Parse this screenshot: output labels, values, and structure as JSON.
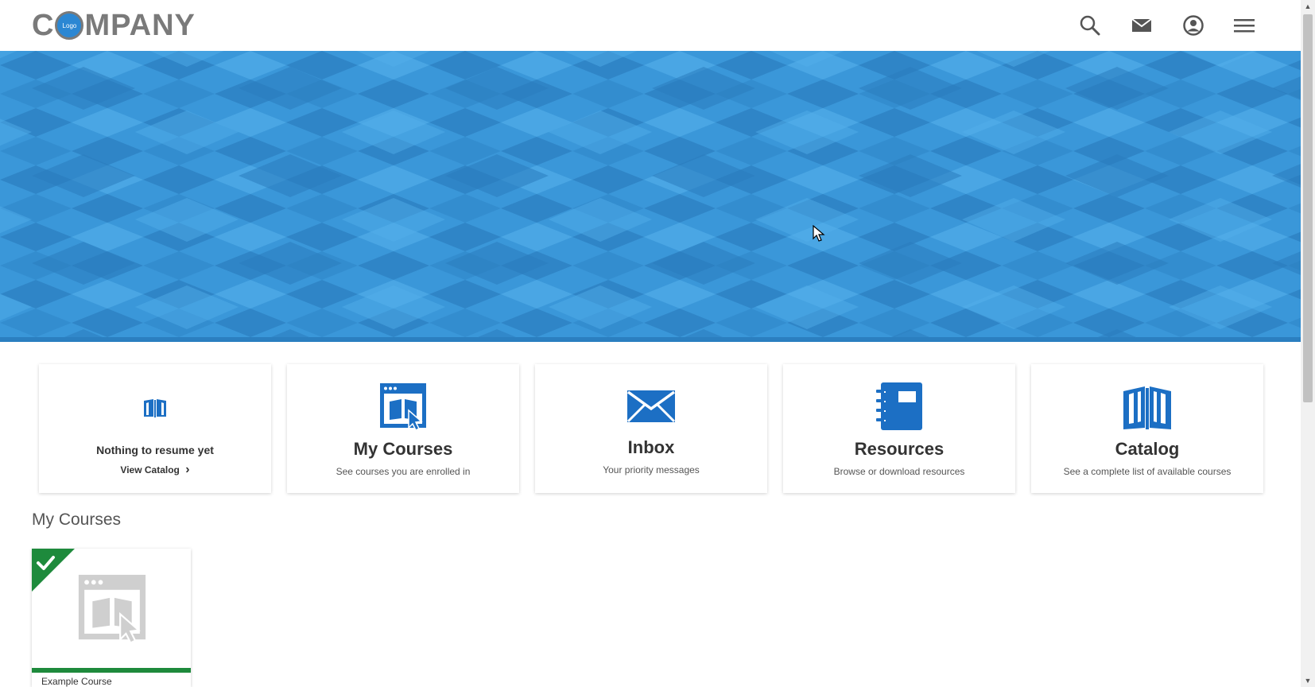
{
  "header": {
    "logo_pre": "C",
    "logo_badge": "Logo",
    "logo_post": "MPANY",
    "icons": [
      "search-icon",
      "mail-icon",
      "account-icon",
      "menu-icon"
    ]
  },
  "banner": {
    "color": "#3a97d9"
  },
  "tiles": {
    "resume": {
      "title": "Nothing to resume yet",
      "link": "View Catalog",
      "link_arrow": "›"
    },
    "my_courses": {
      "title": "My Courses",
      "subtitle": "See courses you are enrolled in"
    },
    "inbox": {
      "title": "Inbox",
      "subtitle": "Your priority messages"
    },
    "resources": {
      "title": "Resources",
      "subtitle": "Browse or download resources"
    },
    "catalog": {
      "title": "Catalog",
      "subtitle": "See a complete list of available courses"
    }
  },
  "my_courses_section": {
    "title": "My Courses",
    "courses": [
      {
        "name": "Example Course",
        "status": "completed",
        "progress_percent": 100
      }
    ]
  },
  "colors": {
    "accent_blue": "#1c6fc4",
    "complete_green": "#1e8a3c",
    "text_dark": "#333333"
  }
}
